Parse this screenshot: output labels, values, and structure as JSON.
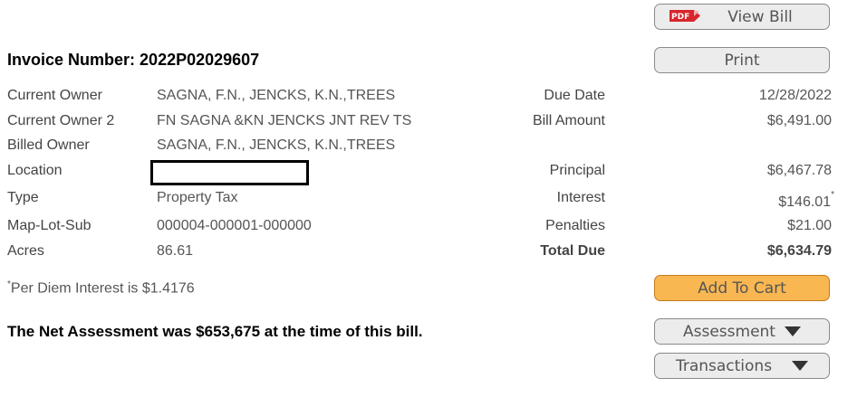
{
  "header": {
    "invoice_label": "Invoice Number:",
    "invoice_number": "2022P02029607"
  },
  "details": {
    "current_owner": {
      "label": "Current Owner",
      "value": "SAGNA, F.N., JENCKS, K.N.,TREES"
    },
    "current_owner_2": {
      "label": "Current Owner 2",
      "value": "FN SAGNA &KN JENCKS JNT REV TS"
    },
    "billed_owner": {
      "label": "Billed Owner",
      "value": "SAGNA, F.N., JENCKS, K.N.,TREES"
    },
    "location": {
      "label": "Location",
      "value": ""
    },
    "type": {
      "label": "Type",
      "value": "Property Tax"
    },
    "map_lot_sub": {
      "label": "Map-Lot-Sub",
      "value": "000004-000001-000000"
    },
    "acres": {
      "label": "Acres",
      "value": "86.61"
    }
  },
  "bill": {
    "due_date": {
      "label": "Due Date",
      "value": "12/28/2022"
    },
    "bill_amount": {
      "label": "Bill Amount",
      "value": "$6,491.00"
    },
    "principal": {
      "label": "Principal",
      "value": "$6,467.78"
    },
    "interest": {
      "label": "Interest",
      "value": "$146.01",
      "mark": "*"
    },
    "penalties": {
      "label": "Penalties",
      "value": "$21.00"
    },
    "total_due": {
      "label": "Total Due",
      "value": "$6,634.79"
    }
  },
  "notes": {
    "per_diem_mark": "*",
    "per_diem": "Per Diem Interest is $1.4176",
    "net_assessment": "The Net Assessment was $653,675 at the time of this bill."
  },
  "buttons": {
    "pdf_badge": "PDF",
    "view_bill": "View Bill",
    "print": "Print",
    "add_to_cart": "Add To Cart",
    "assessment": "Assessment",
    "transactions": "Transactions"
  },
  "colors": {
    "cart_button": "#f9b752",
    "default_button": "#ececec",
    "pdf_icon": "#d8262c"
  }
}
